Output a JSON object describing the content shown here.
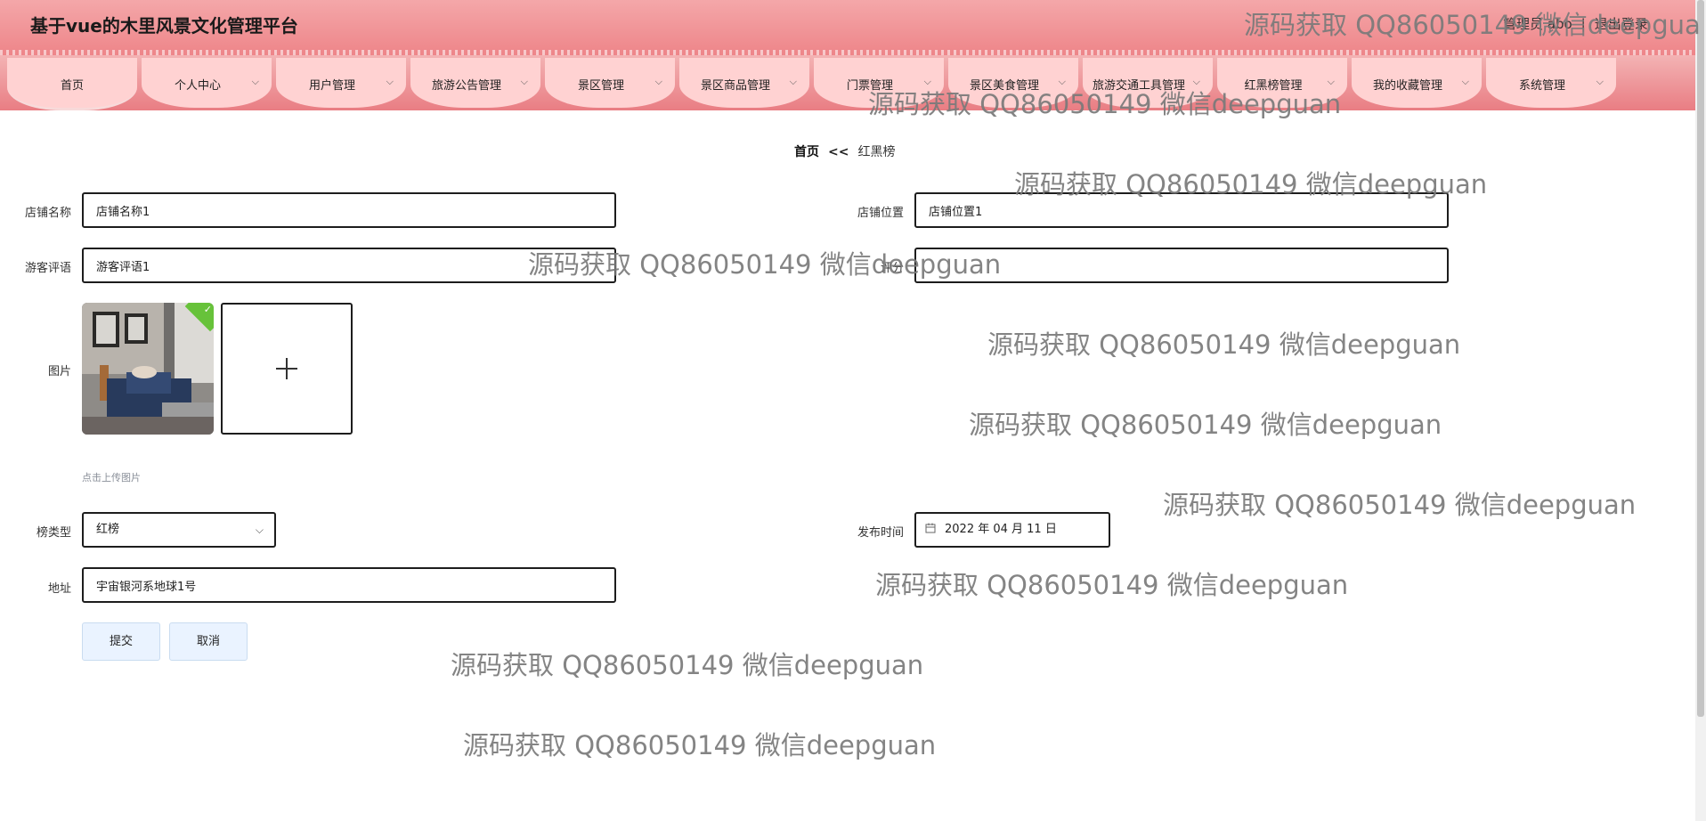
{
  "app": {
    "title": "基于vue的木里风景文化管理平台"
  },
  "user": {
    "label": "管理员 abo",
    "logout": "退出登录"
  },
  "nav": {
    "items": [
      {
        "label": "首页"
      },
      {
        "label": "个人中心"
      },
      {
        "label": "用户管理"
      },
      {
        "label": "旅游公告管理"
      },
      {
        "label": "景区管理"
      },
      {
        "label": "景区商品管理"
      },
      {
        "label": "门票管理"
      },
      {
        "label": "景区美食管理"
      },
      {
        "label": "旅游交通工具管理"
      },
      {
        "label": "红黑榜管理"
      },
      {
        "label": "我的收藏管理"
      },
      {
        "label": "系统管理"
      }
    ]
  },
  "breadcrumb": {
    "home": "首页",
    "sep": "<<",
    "current": "红黑榜"
  },
  "form": {
    "shop_name": {
      "label": "店铺名称",
      "value": "店铺名称1"
    },
    "shop_location": {
      "label": "店铺位置",
      "value": "店铺位置1"
    },
    "review": {
      "label": "游客评语",
      "value": "游客评语1"
    },
    "score": {
      "label": "评分",
      "value": ""
    },
    "image": {
      "label": "图片",
      "tip": "点击上传图片"
    },
    "list_type": {
      "label": "榜类型",
      "value": "红榜"
    },
    "publish_time": {
      "label": "发布时间",
      "value": "2022 年 04 月 11 日"
    },
    "address": {
      "label": "地址",
      "value": "宇宙银河系地球1号"
    }
  },
  "buttons": {
    "submit": "提交",
    "cancel": "取消"
  },
  "watermark": "源码获取 QQ86050149 微信deepguan",
  "watermark_partial": "源码获取 QQ86050149 微信deepgua",
  "colors": {
    "header": "#ee8589",
    "tab": "#ffd2d2",
    "button": "#eaf3ff"
  },
  "icons": {
    "dropdown": "chevron-down-icon",
    "calendar": "calendar-icon",
    "upload": "plus-icon",
    "success": "check-icon"
  }
}
